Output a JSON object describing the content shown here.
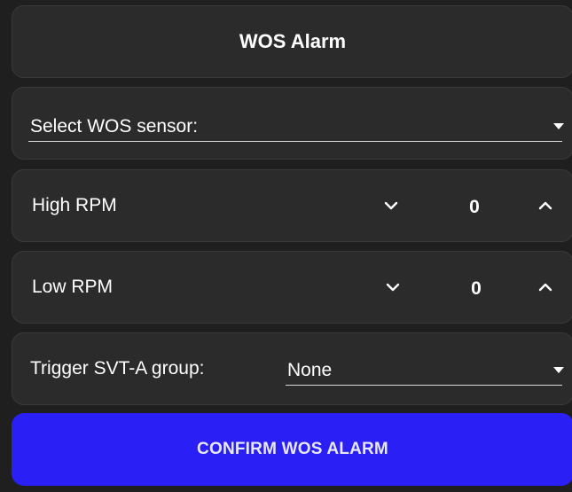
{
  "title": "WOS Alarm",
  "sensor_select": {
    "label": "Select WOS sensor:"
  },
  "high_rpm": {
    "label": "High RPM",
    "value": "0"
  },
  "low_rpm": {
    "label": "Low RPM",
    "value": "0"
  },
  "trigger": {
    "label": "Trigger SVT-A group:",
    "value": "None"
  },
  "confirm_label": "CONFIRM WOS ALARM",
  "colors": {
    "background": "#1f1f1f",
    "card": "#2b2b2b",
    "accent": "#2a1ff5"
  },
  "icons": {
    "dropdown": "caret-down-icon",
    "decrement": "chevron-down-icon",
    "increment": "chevron-up-icon"
  }
}
